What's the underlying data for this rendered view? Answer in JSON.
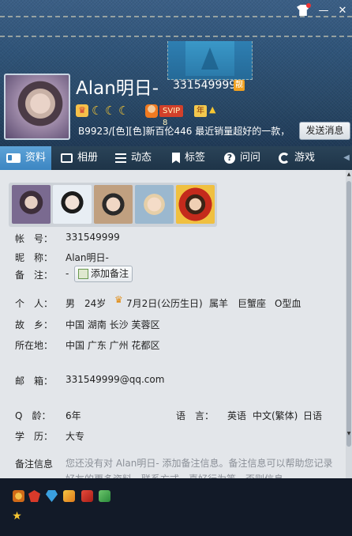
{
  "window": {
    "controls": {
      "minimize": "—",
      "close": "✕"
    }
  },
  "profile": {
    "name": "Alan明日-",
    "qq_number": "331549999",
    "liang_badge": "靓",
    "svip_badge": "SVIP 8",
    "svip_year": "年",
    "signature": "B9923/[色][色]新百伦446 最近销量超好的一款，",
    "send_button": "发送消息"
  },
  "tabs": [
    {
      "label": "资料",
      "icon": "id-card-icon",
      "active": true
    },
    {
      "label": "相册",
      "icon": "photo-album-icon",
      "active": false
    },
    {
      "label": "动态",
      "icon": "feed-list-icon",
      "active": false
    },
    {
      "label": "标签",
      "icon": "bookmark-icon",
      "active": false
    },
    {
      "label": "问问",
      "icon": "question-icon",
      "active": false
    },
    {
      "label": "游戏",
      "icon": "game-icon",
      "active": false
    }
  ],
  "details": {
    "account_label": "帐　号：",
    "account_value": "331549999",
    "nickname_label": "昵　称：",
    "nickname_value": "Alan明日-",
    "remark_label": "备　注：",
    "remark_value": "-",
    "add_remark_button": "添加备注",
    "personal_label": "个　人：",
    "gender": "男",
    "age": "24岁",
    "birthday": "7月2日(公历生日)",
    "zodiac": "属羊",
    "constellation": "巨蟹座",
    "blood_type": "O型血",
    "hometown_label": "故　乡：",
    "hometown_value": "中国 湖南 长沙 芙蓉区",
    "location_label": "所在地：",
    "location_value": "中国 广东 广州 花都区",
    "email_label": "邮　箱：",
    "email_value": "331549999@qq.com",
    "qq_age_label": "Q　龄：",
    "qq_age_value": "6年",
    "language_label": "语　言：",
    "languages": [
      "英语",
      "中文(繁体)",
      "日语"
    ],
    "education_label": "学　历：",
    "education_value": "大专",
    "remark_info_label": "备注信息",
    "remark_info_text": "您还没有对 Alan明日- 添加备注信息。备注信息可以帮助您记录好友的更多资料，联系方式，喜好行为等，否则信息"
  },
  "colors": {
    "header_denim": "#2f5479",
    "tab_bar": "#1e3448",
    "tab_active": "#4a94cc",
    "content_bg": "#e3e6ea",
    "bottom_bar": "#121a28"
  }
}
